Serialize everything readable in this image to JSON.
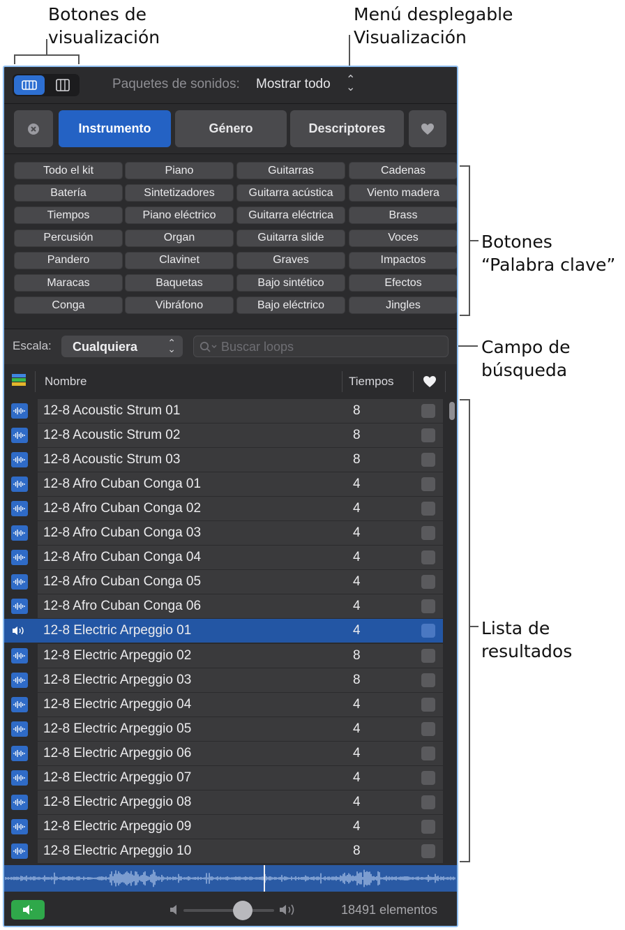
{
  "callouts": {
    "view_buttons": [
      "Botones de",
      "visualización"
    ],
    "view_menu": [
      "Menú desplegable",
      "Visualización"
    ],
    "keyword_buttons": [
      "Botones",
      "“Palabra clave”"
    ],
    "search_field": [
      "Campo de",
      "búsqueda"
    ],
    "results_list": [
      "Lista de",
      "resultados"
    ]
  },
  "toolbar": {
    "packs_label": "Paquetes de sonidos:",
    "packs_value": "Mostrar todo"
  },
  "tabs": {
    "instrument": "Instrumento",
    "genre": "Género",
    "descriptors": "Descriptores"
  },
  "keywords": [
    "Todo el kit",
    "Piano",
    "Guitarras",
    "Cadenas",
    "Batería",
    "Sintetizadores",
    "Guitarra acústica",
    "Viento madera",
    "Tiempos",
    "Piano eléctrico",
    "Guitarra eléctrica",
    "Brass",
    "Percusión",
    "Organ",
    "Guitarra slide",
    "Voces",
    "Pandero",
    "Clavinet",
    "Graves",
    "Impactos",
    "Maracas",
    "Baquetas",
    "Bajo sintético",
    "Efectos",
    "Conga",
    "Vibráfono",
    "Bajo eléctrico",
    "Jingles"
  ],
  "filter": {
    "scale_label": "Escala:",
    "scale_value": "Cualquiera",
    "search_placeholder": "Buscar loops"
  },
  "columns": {
    "name": "Nombre",
    "beats": "Tiempos"
  },
  "rows": [
    {
      "name": "12-8 Acoustic Strum 01",
      "beats": "8"
    },
    {
      "name": "12-8 Acoustic Strum 02",
      "beats": "8"
    },
    {
      "name": "12-8 Acoustic Strum 03",
      "beats": "8"
    },
    {
      "name": "12-8 Afro Cuban Conga 01",
      "beats": "4"
    },
    {
      "name": "12-8 Afro Cuban Conga 02",
      "beats": "4"
    },
    {
      "name": "12-8 Afro Cuban Conga 03",
      "beats": "4"
    },
    {
      "name": "12-8 Afro Cuban Conga 04",
      "beats": "4"
    },
    {
      "name": "12-8 Afro Cuban Conga 05",
      "beats": "4"
    },
    {
      "name": "12-8 Afro Cuban Conga 06",
      "beats": "4"
    },
    {
      "name": "12-8 Electric Arpeggio 01",
      "beats": "4",
      "selected": true
    },
    {
      "name": "12-8 Electric Arpeggio 02",
      "beats": "8"
    },
    {
      "name": "12-8 Electric Arpeggio 03",
      "beats": "8"
    },
    {
      "name": "12-8 Electric Arpeggio 04",
      "beats": "4"
    },
    {
      "name": "12-8 Electric Arpeggio 05",
      "beats": "4"
    },
    {
      "name": "12-8 Electric Arpeggio 06",
      "beats": "4"
    },
    {
      "name": "12-8 Electric Arpeggio 07",
      "beats": "4"
    },
    {
      "name": "12-8 Electric Arpeggio 08",
      "beats": "4"
    },
    {
      "name": "12-8 Electric Arpeggio 09",
      "beats": "4"
    },
    {
      "name": "12-8 Electric Arpeggio 10",
      "beats": "8"
    }
  ],
  "footer": {
    "item_count": "18491 elementos",
    "volume_level": 0.7
  },
  "icons": [
    "view-rows-icon",
    "view-columns-icon",
    "chevron-updown-icon",
    "clear-x-icon",
    "heart-icon",
    "search-icon",
    "color-stripes-icon",
    "waveform-icon",
    "speaker-icon",
    "volume-low-icon",
    "volume-high-icon"
  ],
  "colors": {
    "accent": "#2462c4",
    "selected_row": "#2356a4",
    "preview_green": "#2fa84a",
    "panel_bg": "#2b2b2d",
    "focus_border": "#8fbef0"
  }
}
